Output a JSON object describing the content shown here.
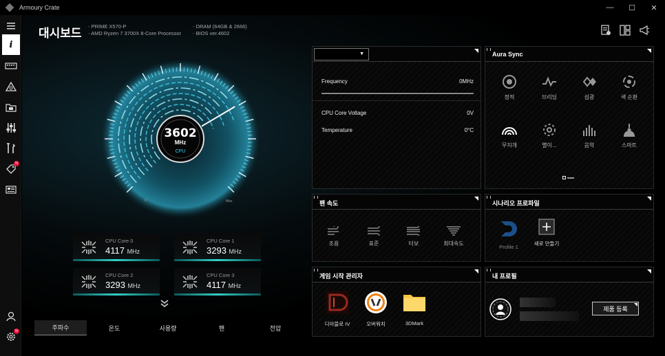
{
  "window": {
    "title": "Armoury Crate",
    "minimize": "—",
    "maximize": "☐",
    "close": "✕"
  },
  "page": {
    "title": "대시보드"
  },
  "sysinfo": {
    "left": [
      "PRIME X570-P",
      "AMD Ryzen 7 3700X 8-Core Processor"
    ],
    "right": [
      "DRAM (64GB & 2666)",
      "BIOS ver.4602"
    ]
  },
  "gauge": {
    "value": "3602",
    "unit": "MHz",
    "label": "CPU",
    "min": "0",
    "max": "Max",
    "fraction": 0.72
  },
  "cores": [
    {
      "name": "CPU Core 0",
      "value": "4117",
      "unit": "MHz"
    },
    {
      "name": "CPU Core 1",
      "value": "3293",
      "unit": "MHz"
    },
    {
      "name": "CPU Core 2",
      "value": "3293",
      "unit": "MHz"
    },
    {
      "name": "CPU Core 3",
      "value": "4117",
      "unit": "MHz"
    }
  ],
  "tabs": [
    "주파수",
    "온도",
    "사용량",
    "팬",
    "전압"
  ],
  "monitor": {
    "rows": [
      {
        "label": "Frequency",
        "value": "0MHz"
      },
      {
        "label": "CPU Core Voltage",
        "value": "0V"
      },
      {
        "label": "Temperature",
        "value": "0°C"
      }
    ]
  },
  "aura": {
    "title": "Aura Sync",
    "items": [
      "정적",
      "브리딩",
      "섬광",
      "색 순환",
      "무지개",
      "별이...",
      "음악",
      "스마트"
    ]
  },
  "fan": {
    "title": "팬 속도",
    "items": [
      "조용",
      "표준",
      "터보",
      "최대속도"
    ]
  },
  "scenario": {
    "title": "시나리오 프로파일",
    "profile": "Profile 1",
    "new": "새로 만들기"
  },
  "games": {
    "title": "게임 시작 관리자",
    "items": [
      "디아블로 IV",
      "오버워치",
      "3DMark"
    ]
  },
  "profile": {
    "title": "내 프로필",
    "register": "제품 등록"
  },
  "colors": {
    "accent": "#2fd8ff",
    "badge": "#e0103a",
    "core_bar": "#33d0c8"
  }
}
